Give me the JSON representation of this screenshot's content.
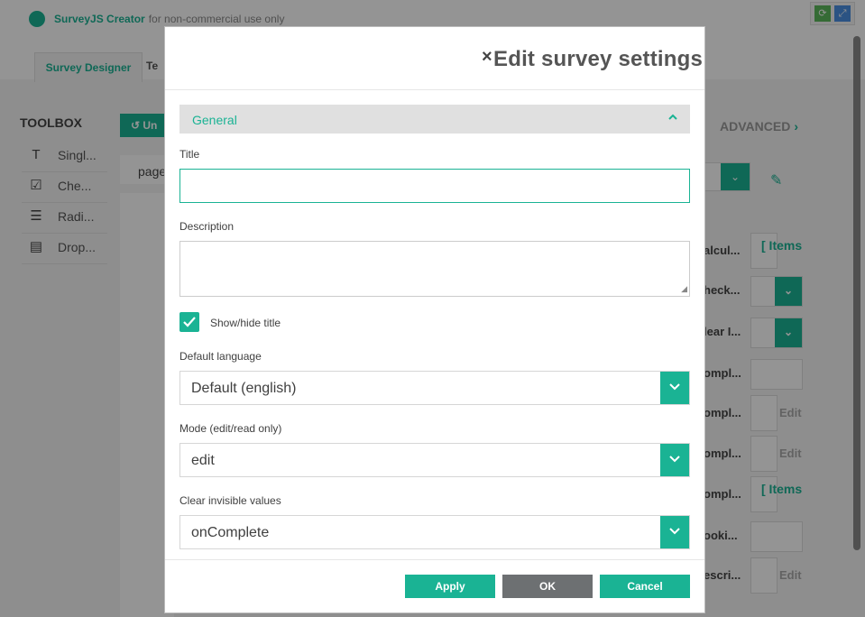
{
  "app": {
    "brand": "SurveyJS Creator",
    "brand_sub": "for non-commercial use only",
    "tabs": [
      {
        "label": "Survey Designer"
      },
      {
        "label": "Te"
      }
    ],
    "toolbox": {
      "title": "TOOLBOX",
      "items": [
        {
          "label": "Singl...",
          "icon": "text-icon"
        },
        {
          "label": "Che...",
          "icon": "checkbox-icon"
        },
        {
          "label": "Radi...",
          "icon": "radiogroup-icon"
        },
        {
          "label": "Drop...",
          "icon": "dropdown-icon"
        }
      ]
    },
    "undo_label": "Un",
    "page_selector": "page",
    "advanced_label": "ADVANCED",
    "advanced_chevron": "›",
    "property_rows": [
      {
        "name": "alcul...",
        "kind": "items",
        "value": "[ Items"
      },
      {
        "name": "heck...",
        "kind": "dropdown"
      },
      {
        "name": "lear I...",
        "kind": "dropdown"
      },
      {
        "name": "ompl...",
        "kind": "empty"
      },
      {
        "name": "ompl...",
        "kind": "edit",
        "value": "Edit"
      },
      {
        "name": "ompl...",
        "kind": "edit",
        "value": "Edit"
      },
      {
        "name": "ompl...",
        "kind": "items",
        "value": "[ Items"
      },
      {
        "name": "ooki...",
        "kind": "empty"
      },
      {
        "name": "escri...",
        "kind": "edit",
        "value": "Edit"
      }
    ],
    "colors": {
      "accent": "#1ab394",
      "ok_button": "#6d7072"
    }
  },
  "modal": {
    "close_glyph": "×",
    "title": "Edit survey settings",
    "section": {
      "label": "General",
      "expanded": true
    },
    "fields": {
      "title_label": "Title",
      "title_value": "",
      "description_label": "Description",
      "description_value": "",
      "show_title_label": "Show/hide title",
      "show_title_checked": true,
      "language_label": "Default language",
      "language_value": "Default (english)",
      "mode_label": "Mode (edit/read only)",
      "mode_value": "edit",
      "clear_label": "Clear invisible values",
      "clear_value": "onComplete"
    },
    "buttons": {
      "apply": "Apply",
      "ok": "OK",
      "cancel": "Cancel"
    }
  }
}
